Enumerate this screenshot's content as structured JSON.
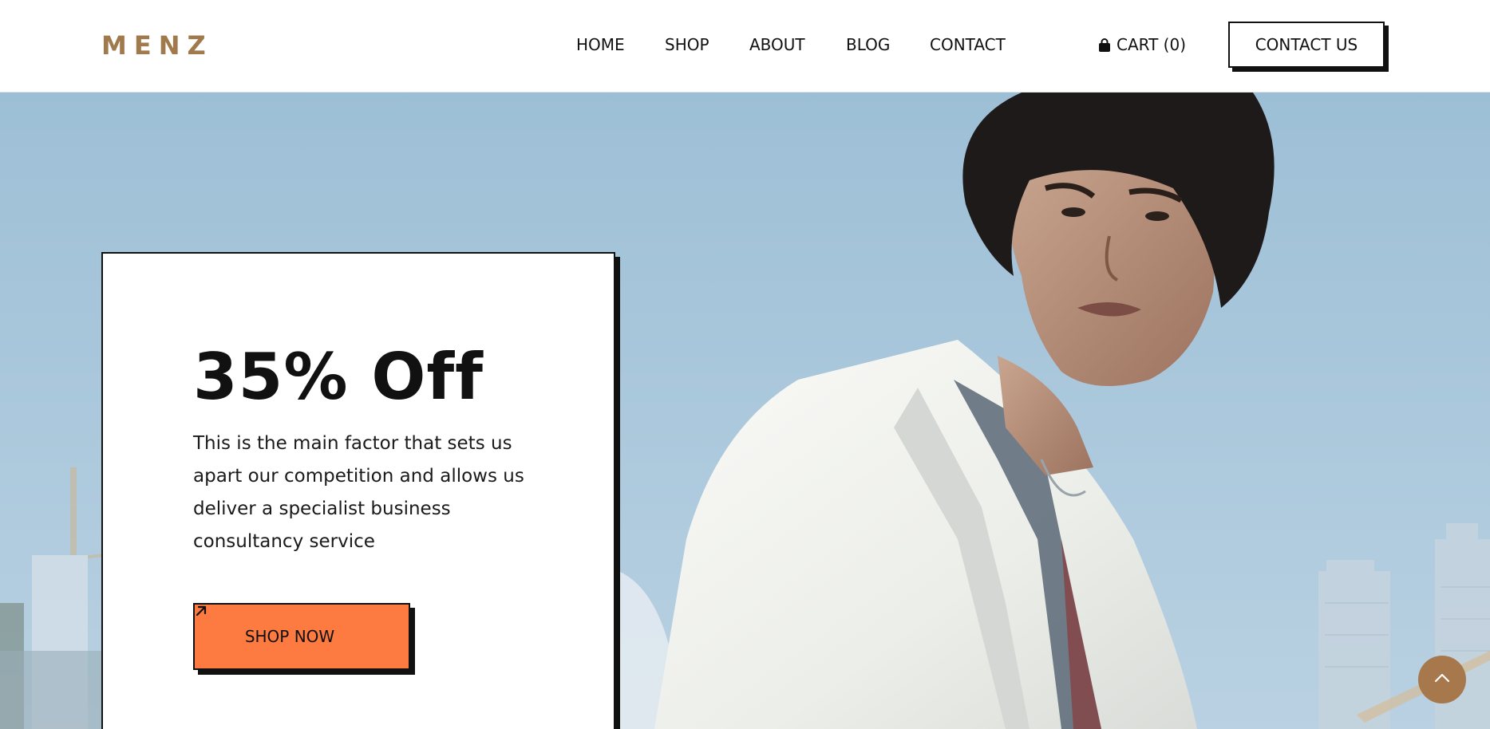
{
  "header": {
    "logo": "MENZ",
    "nav": [
      {
        "label": "HOME",
        "name": "nav-home"
      },
      {
        "label": "SHOP",
        "name": "nav-shop"
      },
      {
        "label": "ABOUT",
        "name": "nav-about"
      },
      {
        "label": "BLOG",
        "name": "nav-blog"
      },
      {
        "label": "CONTACT",
        "name": "nav-contact"
      }
    ],
    "cart_label": "CART (0)",
    "cart_icon": "shopping-bag-icon",
    "contact_button": "CONTACT US"
  },
  "hero": {
    "promo": {
      "title": "35% Off",
      "text": "This is the main factor that sets us apart our competition and allows us deliver a specialist business consultancy service",
      "button_label": "SHOP NOW",
      "button_icon": "arrow-up-right-icon"
    },
    "image": "man-in-white-jacket-photo",
    "scroll_top_icon": "chevron-up-icon"
  },
  "colors": {
    "logo": "#a0794d",
    "accent_button": "#fd7a40",
    "scroll_top": "#a6784c",
    "sky": "#a9c7dc"
  }
}
